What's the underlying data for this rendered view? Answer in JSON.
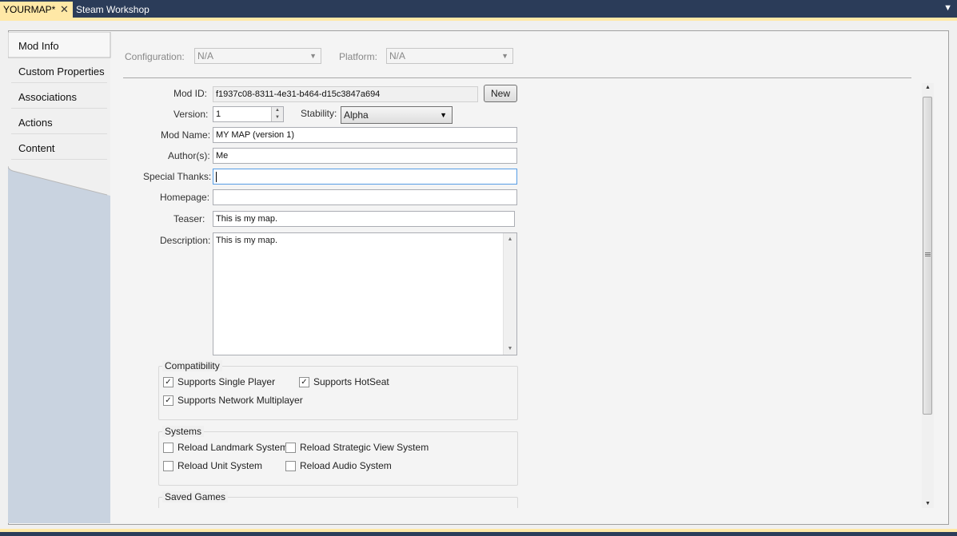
{
  "tabs": {
    "active_label": "YOURMAP*",
    "close_glyph": "✕",
    "inactive_label": "Steam Workshop",
    "menu_icon": "chevron-down-icon"
  },
  "sidebar": {
    "items": [
      {
        "label": "Mod Info"
      },
      {
        "label": "Custom Properties"
      },
      {
        "label": "Associations"
      },
      {
        "label": "Actions"
      },
      {
        "label": "Content"
      }
    ]
  },
  "config": {
    "configuration_label": "Configuration:",
    "configuration_value": "N/A",
    "platform_label": "Platform:",
    "platform_value": "N/A"
  },
  "form": {
    "mod_id_label": "Mod ID:",
    "mod_id_value": "f1937c08-8311-4e31-b464-d15c3847a694",
    "new_button": "New",
    "version_label": "Version:",
    "version_value": "1",
    "stability_label": "Stability:",
    "stability_value": "Alpha",
    "mod_name_label": "Mod Name:",
    "mod_name_value": "MY MAP (version 1)",
    "authors_label": "Author(s):",
    "authors_value": "Me",
    "special_thanks_label": "Special Thanks:",
    "special_thanks_value": "",
    "homepage_label": "Homepage:",
    "homepage_value": "",
    "teaser_label": "Teaser:",
    "teaser_value": "This is my map.",
    "description_label": "Description:",
    "description_value": "This is my map."
  },
  "compatibility": {
    "title": "Compatibility",
    "single_player": {
      "label": "Supports Single Player",
      "checked": true
    },
    "hotseat": {
      "label": "Supports HotSeat",
      "checked": true
    },
    "network": {
      "label": "Supports Network Multiplayer",
      "checked": true
    }
  },
  "systems": {
    "title": "Systems",
    "landmark": {
      "label": "Reload Landmark System",
      "checked": false
    },
    "strategic": {
      "label": "Reload Strategic View System",
      "checked": false
    },
    "unit": {
      "label": "Reload Unit System",
      "checked": false
    },
    "audio": {
      "label": "Reload Audio System",
      "checked": false
    }
  },
  "saved_games": {
    "title": "Saved Games"
  },
  "colors": {
    "tab_accent": "#ffe8a6",
    "frame_dark": "#2b3c59",
    "sidebar": "#c9d3e0"
  }
}
